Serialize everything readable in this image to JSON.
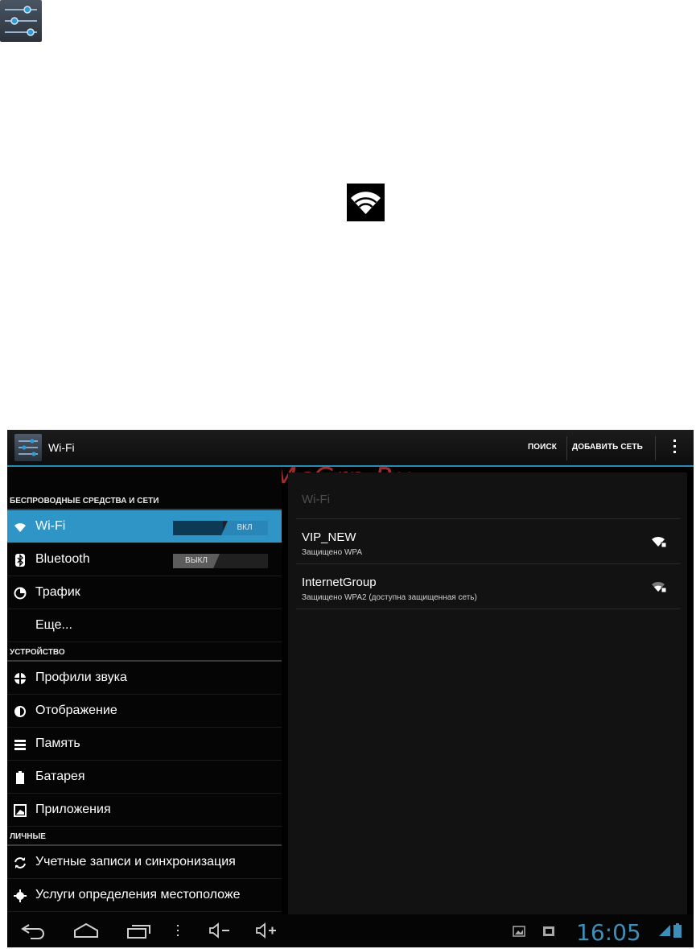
{
  "action_bar": {
    "title": "Wi-Fi",
    "search_label": "ПОИСК",
    "add_network_label": "ДОБАВИТЬ СЕТЬ"
  },
  "left_pane": {
    "section_wireless": "БЕСПРОВОДНЫЕ СРЕДСТВА И СЕТИ",
    "wifi": {
      "label": "Wi-Fi",
      "toggle": "ВКЛ"
    },
    "bluetooth": {
      "label": "Bluetooth",
      "toggle": "ВЫКЛ"
    },
    "traffic": "Трафик",
    "more": "Еще...",
    "section_device": "УСТРОЙСТВО",
    "sound_profiles": "Профили звука",
    "display": "Отображение",
    "memory": "Память",
    "battery": "Батарея",
    "apps": "Приложения",
    "section_personal": "ЛИЧНЫЕ",
    "accounts_sync": "Учетные записи и синхронизация",
    "location": "Услуги определения местоположе"
  },
  "right_pane": {
    "title": "Wi-Fi",
    "networks": [
      {
        "name": "VIP_NEW",
        "security": "Защищено WPA"
      },
      {
        "name": "InternetGroup",
        "security": "Защищено WPA2 (доступна защищенная сеть)"
      }
    ]
  },
  "system_bar": {
    "clock": "16:05"
  },
  "watermark": "McGrp.Ru",
  "colors": {
    "accent": "#2f94c6",
    "clock": "#3d8fb7",
    "watermark": "#c63b3b"
  }
}
